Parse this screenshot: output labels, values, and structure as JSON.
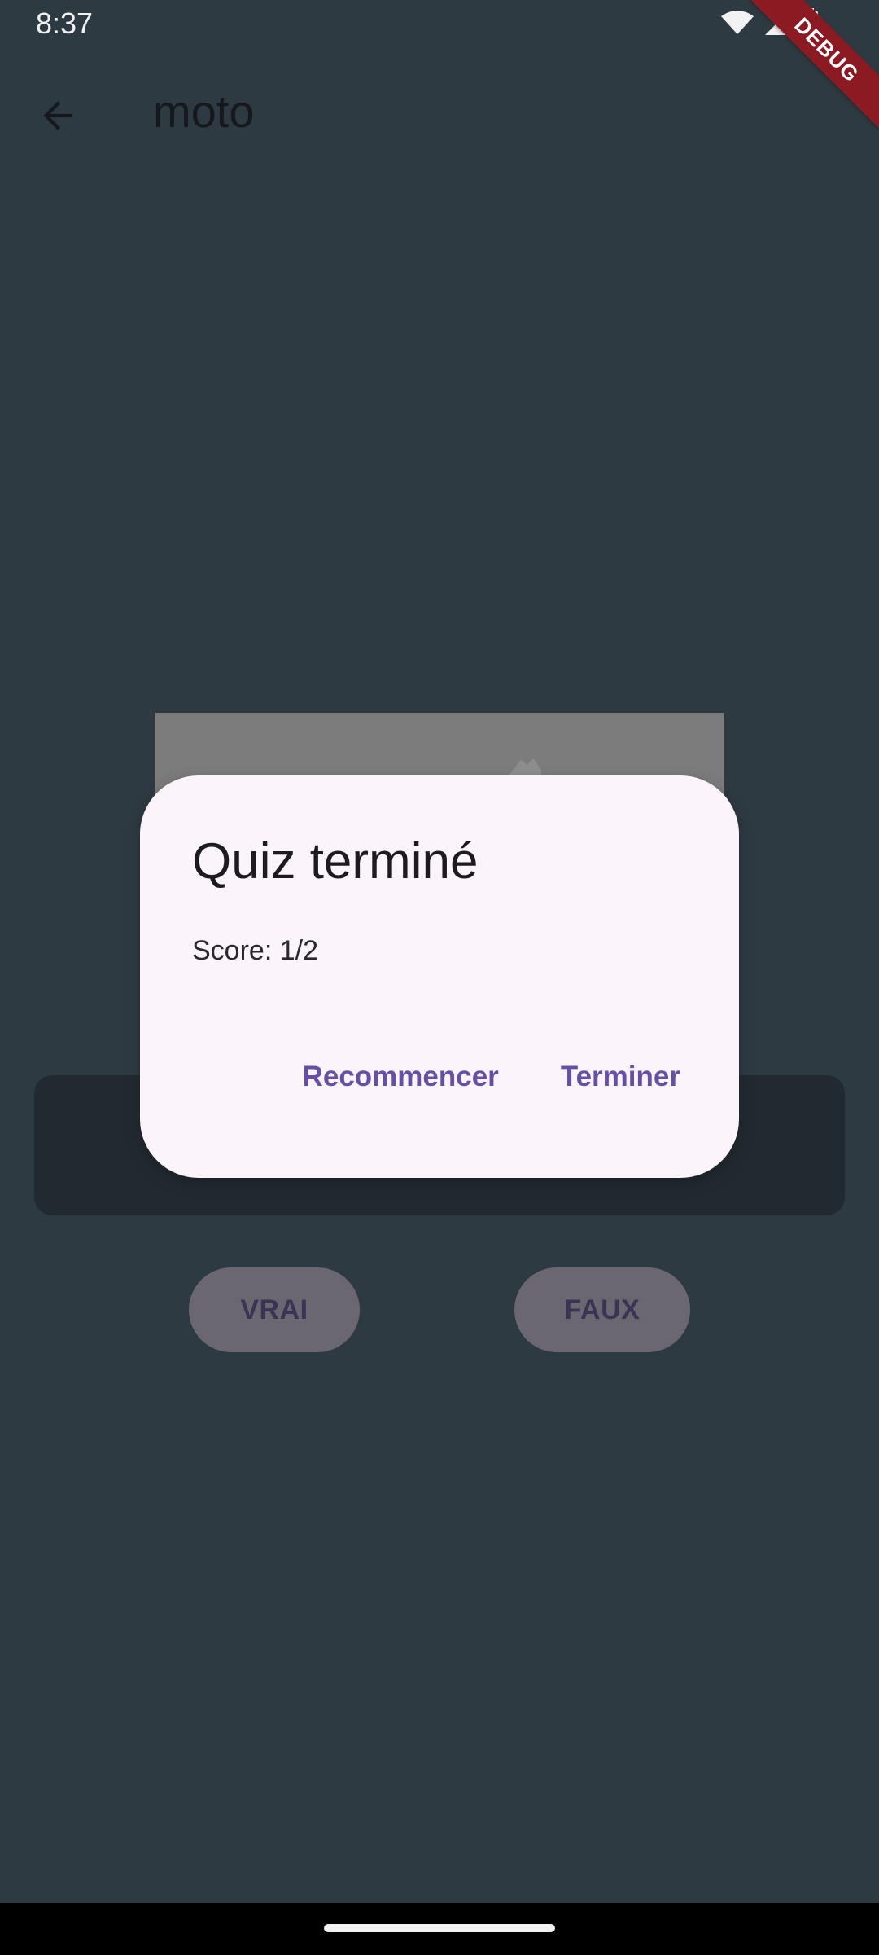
{
  "status_bar": {
    "time": "8:37"
  },
  "debug_banner": {
    "label": "DEBUG"
  },
  "app_bar": {
    "title": "moto"
  },
  "quiz": {
    "true_label": "VRAI",
    "false_label": "FAUX"
  },
  "dialog": {
    "title": "Quiz terminé",
    "content": "Score: 1/2",
    "restart_label": "Recommencer",
    "finish_label": "Terminer"
  },
  "colors": {
    "background": "#2e3a42",
    "dialog_bg": "#fcf4fb",
    "accent": "#6750a4",
    "debug_ribbon": "#8c1a22"
  },
  "icons": {
    "back": "arrow-left-icon",
    "wifi": "wifi-icon",
    "signal": "signal-icon",
    "battery": "battery-icon",
    "image": "image-placeholder-icon"
  }
}
